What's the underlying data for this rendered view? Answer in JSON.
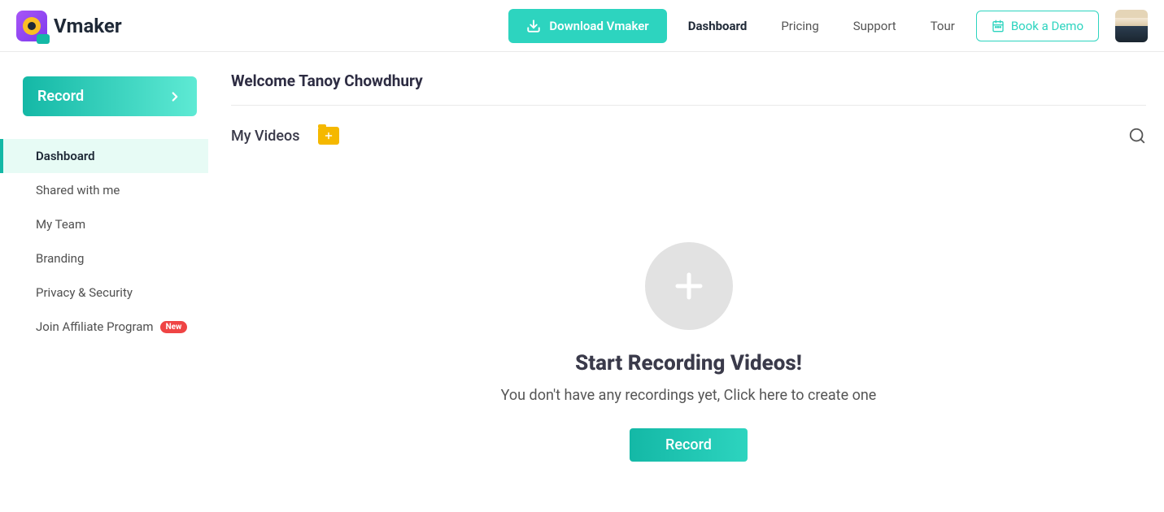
{
  "brand": "Vmaker",
  "header": {
    "download_label": "Download Vmaker",
    "nav": {
      "dashboard": "Dashboard",
      "pricing": "Pricing",
      "support": "Support",
      "tour": "Tour"
    },
    "demo_label": "Book a Demo"
  },
  "sidebar": {
    "record_label": "Record",
    "items": {
      "dashboard": "Dashboard",
      "shared": "Shared with me",
      "team": "My Team",
      "branding": "Branding",
      "privacy": "Privacy & Security",
      "affiliate": "Join Affiliate Program"
    },
    "new_badge": "New"
  },
  "main": {
    "welcome": "Welcome Tanoy Chowdhury",
    "section_title": "My Videos",
    "empty": {
      "title": "Start Recording Videos!",
      "subtitle": "You don't have any recordings yet, Click here to create one",
      "button": "Record"
    }
  }
}
